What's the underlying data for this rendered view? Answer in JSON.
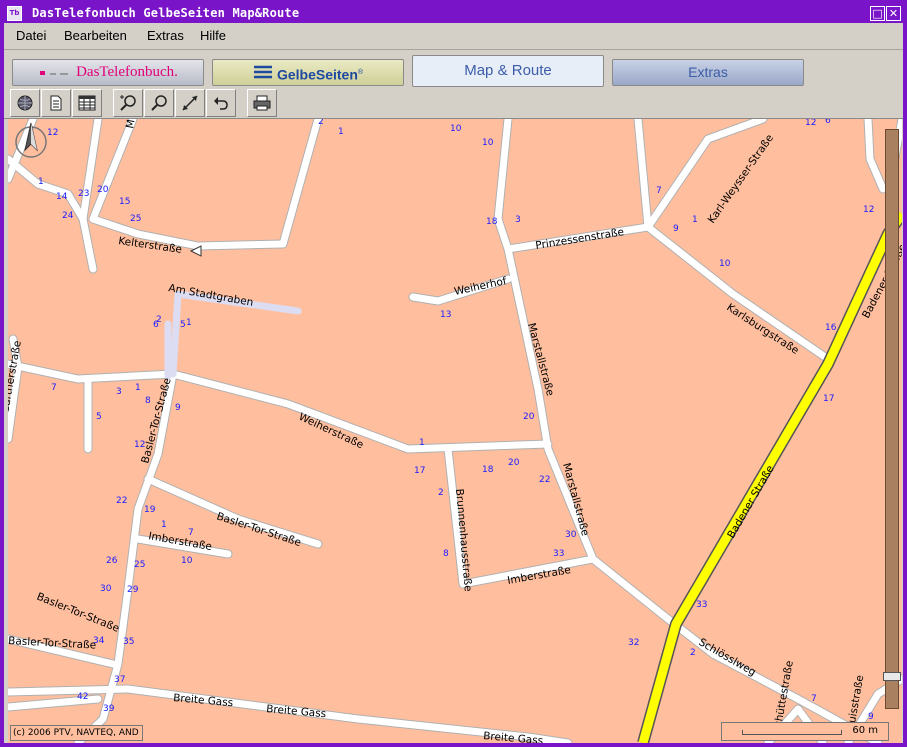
{
  "window": {
    "title": "DasTelefonbuch GelbeSeiten Map&Route",
    "app_icon_text": "Tb",
    "restore_glyph": "□",
    "close_glyph": "✕"
  },
  "menu": {
    "items": [
      "Datei",
      "Bearbeiten",
      "Extras",
      "Hilfe"
    ]
  },
  "tabs": {
    "telefon": "DasTelefonbuch.",
    "gelbe": "GelbeSeiten",
    "map": "Map & Route",
    "extras": "Extras"
  },
  "toolbar": {
    "icons": [
      "globe-icon",
      "document-icon",
      "table-icon",
      "zoom-in-icon",
      "zoom-out-icon",
      "resize-icon",
      "undo-icon",
      "print-icon"
    ]
  },
  "map": {
    "street_labels": [
      "Kelterstraße",
      "Am Stadtgraben",
      "Weiherhof",
      "Prinzessenstraße",
      "Karl-Weysser-Straße",
      "Karlsburgstraße",
      "Badener Straße",
      "Marstallstraße",
      "Weiherstraße",
      "Basler-Tor-Straße",
      "Brunnenhausstraße",
      "Imberstraße",
      "Schlösslweg",
      "Breite Gass",
      "Gärtnerstraße",
      "Mittel",
      "Luisstraße",
      "Schüttestraße"
    ],
    "house_numbers": [
      "12",
      "1",
      "2",
      "1",
      "10",
      "10",
      "12",
      "6",
      "20",
      "15",
      "23",
      "14",
      "24",
      "25",
      "18",
      "3",
      "7",
      "9",
      "1",
      "10",
      "12",
      "9",
      "2",
      "6",
      "5",
      "1",
      "13",
      "16",
      "17",
      "7",
      "3",
      "1",
      "8",
      "9",
      "5",
      "12",
      "20",
      "1",
      "17",
      "18",
      "20",
      "22",
      "2",
      "22",
      "19",
      "1",
      "7",
      "26",
      "25",
      "10",
      "8",
      "30",
      "33",
      "30",
      "29",
      "34",
      "35",
      "37",
      "42",
      "39",
      "33",
      "32",
      "2",
      "7",
      "9"
    ],
    "copyright": "(c) 2006 PTV, NAVTEQ, AND",
    "scale_label": "60 m",
    "colors": {
      "background": "#ffbf9f",
      "road": "#ffffff",
      "road_edge": "#b0b0b0",
      "highway": "#ffff00",
      "pedestrian": "#dcdcf2"
    }
  }
}
